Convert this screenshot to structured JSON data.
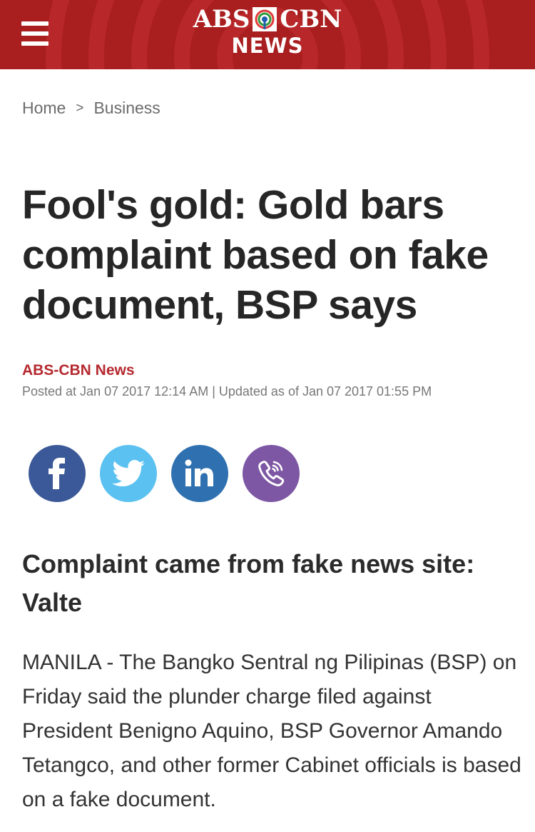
{
  "header": {
    "logo_left": "ABS",
    "logo_right": "CBN",
    "logo_sub": "NEWS",
    "bg_color": "#a91e1e"
  },
  "breadcrumb": {
    "home": "Home",
    "separator": ">",
    "section": "Business"
  },
  "article": {
    "title": "Fool's gold: Gold bars complaint based on fake document, BSP says",
    "author": "ABS-CBN News",
    "dates": "Posted at Jan 07 2017 12:14 AM | Updated as of Jan 07 2017 01:55 PM",
    "subheading": "Complaint came from fake news site: Valte",
    "body": "MANILA - The Bangko Sentral ng Pilipinas (BSP) on Friday said the plunder charge filed against President Benigno Aquino, BSP Governor Amando Tetangco, and other former Cabinet officials is based on a fake document."
  },
  "share": [
    {
      "name": "facebook",
      "icon": "facebook-icon",
      "color": "#3b5998"
    },
    {
      "name": "twitter",
      "icon": "twitter-icon",
      "color": "#5bc1f0"
    },
    {
      "name": "linkedin",
      "icon": "linkedin-icon",
      "color": "#2f71b0"
    },
    {
      "name": "viber",
      "icon": "viber-icon",
      "color": "#7d56a4"
    }
  ]
}
